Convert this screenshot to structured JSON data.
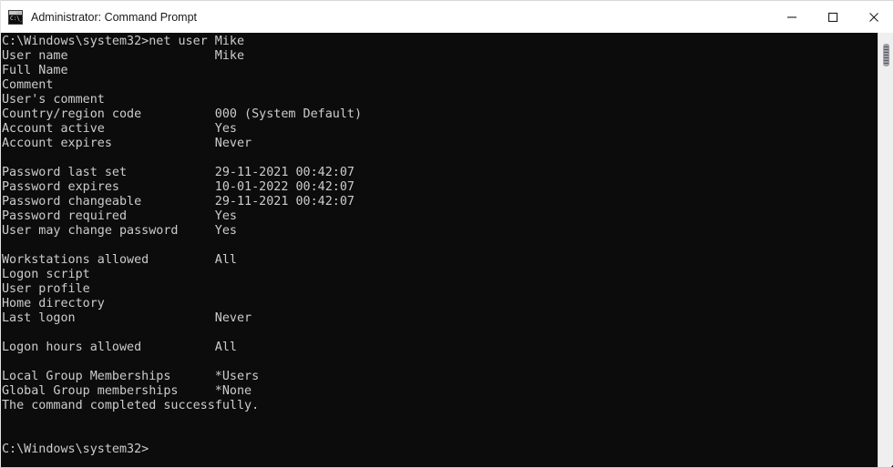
{
  "window": {
    "title": "Administrator: Command Prompt",
    "icon": "command-prompt-icon",
    "icon_glyph": "C:\\_",
    "background_color": "#0c0c0c",
    "foreground_color": "#cccccc",
    "titlebar_color": "#ffffff"
  },
  "controls": {
    "minimize_label": "Minimize",
    "maximize_label": "Maximize",
    "close_label": "Close"
  },
  "scrollbar": {
    "thumb_position": "top",
    "track_color": "#efefef",
    "thumb_color": "#a0a0a8"
  },
  "terminal": {
    "prompt": "C:\\Windows\\system32>",
    "command": "net user Mike",
    "final_prompt": "C:\\Windows\\system32>",
    "status_message": "The command completed successfully.",
    "fields": [
      {
        "label": "User name",
        "value": "Mike"
      },
      {
        "label": "Full Name",
        "value": ""
      },
      {
        "label": "Comment",
        "value": ""
      },
      {
        "label": "User's comment",
        "value": ""
      },
      {
        "label": "Country/region code",
        "value": "000 (System Default)"
      },
      {
        "label": "Account active",
        "value": "Yes"
      },
      {
        "label": "Account expires",
        "value": "Never"
      },
      {
        "label": "Password last set",
        "value": "29-11-2021 00:42:07"
      },
      {
        "label": "Password expires",
        "value": "10-01-2022 00:42:07"
      },
      {
        "label": "Password changeable",
        "value": "29-11-2021 00:42:07"
      },
      {
        "label": "Password required",
        "value": "Yes"
      },
      {
        "label": "User may change password",
        "value": "Yes"
      },
      {
        "label": "Workstations allowed",
        "value": "All"
      },
      {
        "label": "Logon script",
        "value": ""
      },
      {
        "label": "User profile",
        "value": ""
      },
      {
        "label": "Home directory",
        "value": ""
      },
      {
        "label": "Last logon",
        "value": "Never"
      },
      {
        "label": "Logon hours allowed",
        "value": "All"
      },
      {
        "label": "Local Group Memberships",
        "value": "*Users"
      },
      {
        "label": "Global Group memberships",
        "value": "*None"
      }
    ],
    "output_text": "C:\\Windows\\system32>net user Mike\nUser name                    Mike\nFull Name\nComment\nUser's comment\nCountry/region code          000 (System Default)\nAccount active               Yes\nAccount expires              Never\n\nPassword last set            29-11-2021 00:42:07\nPassword expires             10-01-2022 00:42:07\nPassword changeable          29-11-2021 00:42:07\nPassword required            Yes\nUser may change password     Yes\n\nWorkstations allowed         All\nLogon script\nUser profile\nHome directory\nLast logon                   Never\n\nLogon hours allowed          All\n\nLocal Group Memberships      *Users\nGlobal Group memberships     *None\nThe command completed successfully.\n\n\nC:\\Windows\\system32>"
  }
}
